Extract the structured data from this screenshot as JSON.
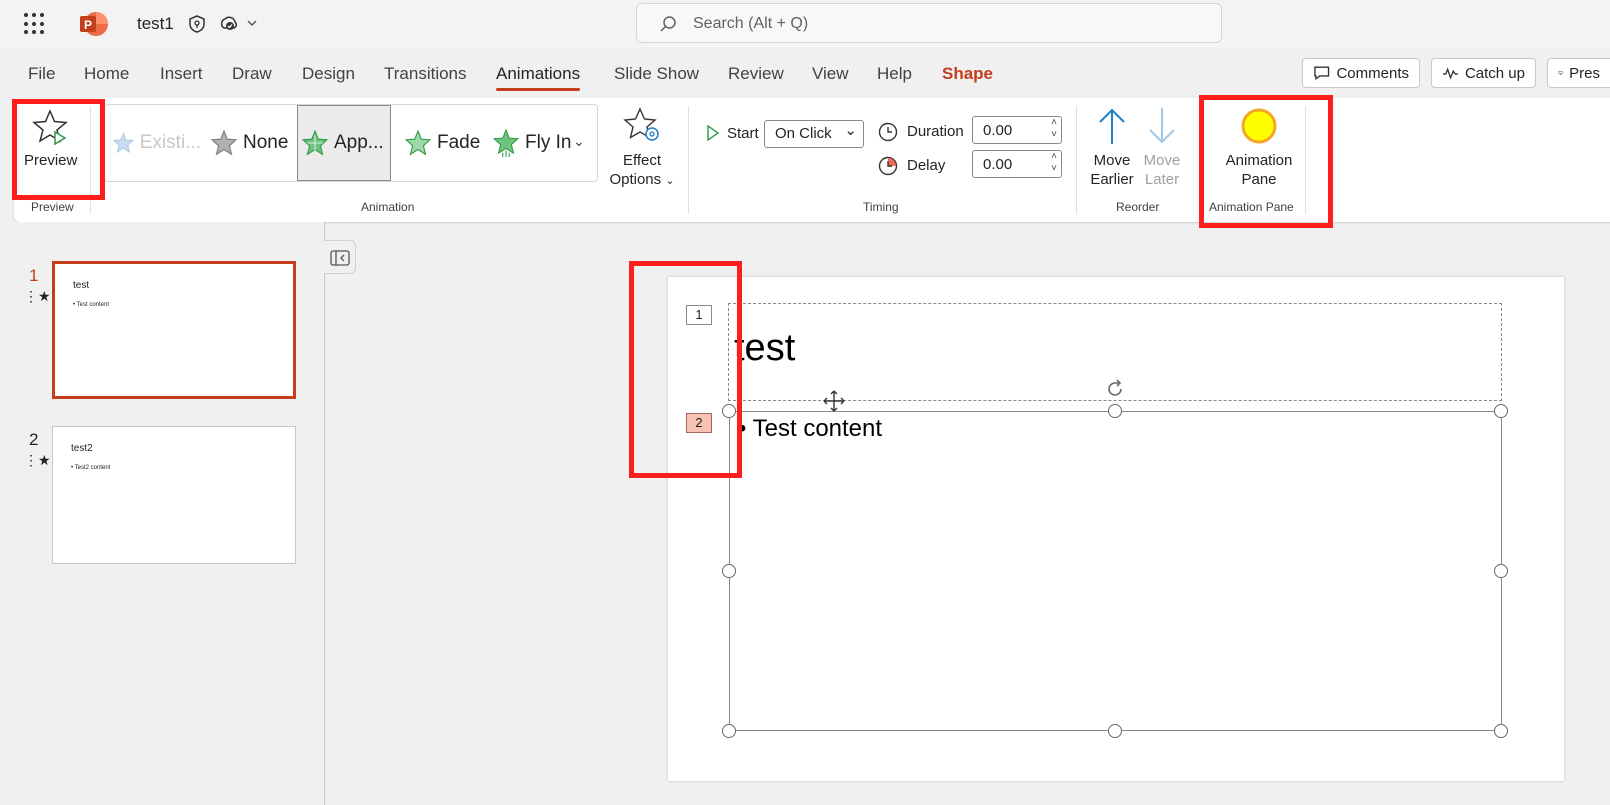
{
  "titlebar": {
    "doc_name": "test1",
    "search_placeholder": "Search (Alt + Q)"
  },
  "tabs": [
    "File",
    "Home",
    "Insert",
    "Draw",
    "Design",
    "Transitions",
    "Animations",
    "Slide Show",
    "Review",
    "View",
    "Help",
    "Shape"
  ],
  "active_tab": "Animations",
  "top_buttons": {
    "comments": "Comments",
    "catch_up": "Catch up",
    "present": "Pres"
  },
  "ribbon": {
    "preview": {
      "label": "Preview",
      "group": "Preview"
    },
    "animation": {
      "group": "Animation",
      "items": [
        {
          "label": "Existi...",
          "state": "disabled"
        },
        {
          "label": "None",
          "state": "normal"
        },
        {
          "label": "App...",
          "state": "selected"
        },
        {
          "label": "Fade",
          "state": "normal"
        },
        {
          "label": "Fly In",
          "state": "normal"
        }
      ],
      "effect_options_line1": "Effect",
      "effect_options_line2": "Options"
    },
    "timing": {
      "group": "Timing",
      "start_label": "Start",
      "start_value": "On Click",
      "duration_label": "Duration",
      "duration_value": "0.00",
      "delay_label": "Delay",
      "delay_value": "0.00"
    },
    "reorder": {
      "group": "Reorder",
      "move_earlier_1": "Move",
      "move_earlier_2": "Earlier",
      "move_later_1": "Move",
      "move_later_2": "Later"
    },
    "animation_pane": {
      "line1": "Animation",
      "line2": "Pane",
      "group": "Animation Pane"
    }
  },
  "slides": [
    {
      "number": "1",
      "title": "test",
      "body": "• Test content"
    },
    {
      "number": "2",
      "title": "test2",
      "body": "• Test2 content"
    }
  ],
  "canvas": {
    "title": "test",
    "content": "• Test content",
    "tag1": "1",
    "tag2": "2"
  },
  "colors": {
    "accent": "#c43e1c",
    "highlight": "#ff1e1e",
    "selected_tag": "#f8c3b4"
  }
}
